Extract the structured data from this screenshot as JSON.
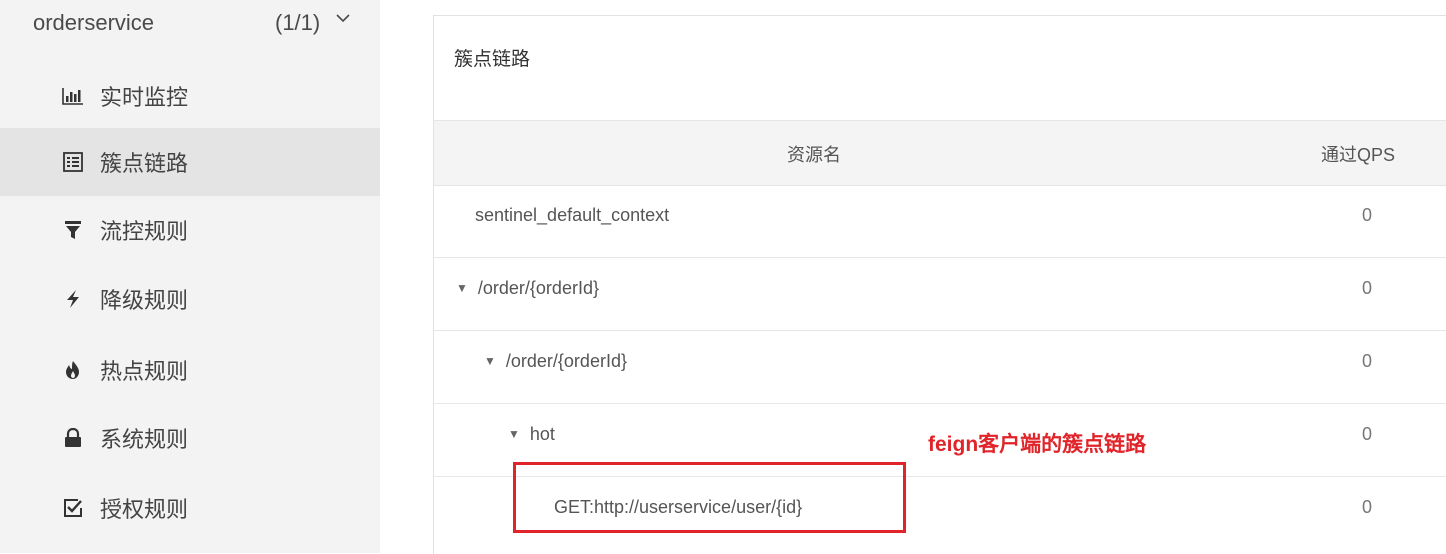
{
  "sidebar": {
    "service_name": "orderservice",
    "service_count": "(1/1)",
    "items": [
      {
        "label": "实时监控",
        "icon": "bar-chart-icon"
      },
      {
        "label": "簇点链路",
        "icon": "list-icon",
        "active": true
      },
      {
        "label": "流控规则",
        "icon": "filter-icon"
      },
      {
        "label": "降级规则",
        "icon": "flash-icon"
      },
      {
        "label": "热点规则",
        "icon": "fire-icon"
      },
      {
        "label": "系统规则",
        "icon": "lock-icon"
      },
      {
        "label": "授权规则",
        "icon": "checkbox-icon"
      }
    ]
  },
  "panel": {
    "title": "簇点链路",
    "columns": [
      "资源名",
      "通过QPS"
    ],
    "rows": [
      {
        "name": "sentinel_default_context",
        "qps": "0",
        "expandable": false
      },
      {
        "name": "/order/{orderId}",
        "qps": "0",
        "expandable": true
      },
      {
        "name": "/order/{orderId}",
        "qps": "0",
        "expandable": true
      },
      {
        "name": "hot",
        "qps": "0",
        "expandable": true
      },
      {
        "name": "GET:http://userservice/user/{id}",
        "qps": "0",
        "expandable": false
      }
    ]
  },
  "annotation": {
    "text": "feign客户端的簇点链路",
    "color": "#e0242a"
  },
  "colors": {
    "sidebar_bg": "#f3f3f3",
    "sidebar_active": "#e4e4e4",
    "table_header_bg": "#f4f4f4"
  }
}
